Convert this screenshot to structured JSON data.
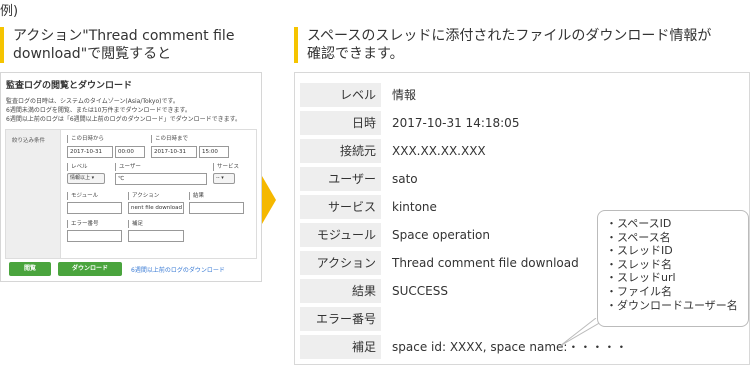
{
  "example_label": "例)",
  "left_caption": "アクション\"Thread comment file download\"で閲覧すると",
  "right_caption": "スペースのスレッドに添付されたファイルのダウンロード情報が確認できます。",
  "mini_screen": {
    "title": "監査ログの閲覧とダウンロード",
    "desc_lines": [
      "監査ログの日時は、システムのタイムゾーン(Asia/Tokyo)です。",
      "6週間未満のログを閲覧、または10万件までダウンロードできます。",
      "6週間以上前のログは「6週間以上前のログのダウンロード」でダウンロードできます。"
    ],
    "filter_label": "絞り込み条件",
    "from_label": "この日時から",
    "from_date": "2017-10-31",
    "from_time": "00:00",
    "to_label": "この日時まで",
    "to_date": "2017-10-31",
    "to_time": "15:00",
    "level_label": "レベル",
    "level_value": "情報以上 ▾",
    "user_label": "ユーザー",
    "user_value": "℃",
    "service_label": "サービス",
    "service_value": "-- ▾",
    "module_label": "モジュール",
    "module_value": "",
    "action_label": "アクション",
    "action_value": "nent file download",
    "result_label": "結果",
    "result_value": "",
    "error_label": "エラー番号",
    "error_value": "",
    "note_label": "補足",
    "note_value": "",
    "view_button": "閲覧",
    "download_button": "ダウンロード",
    "old_logs_link": "6週間以上前のログのダウンロード"
  },
  "detail": {
    "rows": [
      {
        "label": "レベル",
        "value": "情報"
      },
      {
        "label": "日時",
        "value": "2017-10-31 14:18:05"
      },
      {
        "label": "接続元",
        "value": "XXX.XX.XX.XXX"
      },
      {
        "label": "ユーザー",
        "value": "sato"
      },
      {
        "label": "サービス",
        "value": "kintone"
      },
      {
        "label": "モジュール",
        "value": "Space operation"
      },
      {
        "label": "アクション",
        "value": "Thread comment file download"
      },
      {
        "label": "結果",
        "value": "SUCCESS"
      },
      {
        "label": "エラー番号",
        "value": ""
      },
      {
        "label": "補足",
        "value": "space id: XXXX, space name:・・・・・"
      }
    ]
  },
  "callout": {
    "items": [
      "・スペースID",
      "・スペース名",
      "・スレッドID",
      "・スレッド名",
      "・スレッドurl",
      "・ファイル名",
      "・ダウンロードユーザー名"
    ]
  },
  "colors": {
    "accent_yellow": "#f5c400",
    "button_green": "#4aa43d",
    "link_blue": "#3a7bd5",
    "label_bg": "#eeeeee"
  }
}
